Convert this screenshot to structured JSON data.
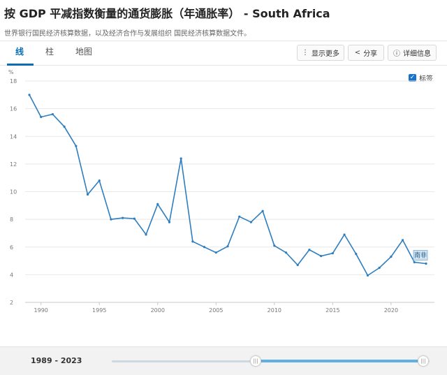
{
  "header": {
    "title": "按 GDP 平减指数衡量的通货膨胀（年通胀率） - South Africa",
    "subtitle": "世界银行国民经济核算数据，以及经济合作与发展组织 国民经济核算数据文件。"
  },
  "tabs": [
    {
      "label": "线",
      "active": true
    },
    {
      "label": "柱",
      "active": false
    },
    {
      "label": "地图",
      "active": false
    }
  ],
  "actions": {
    "more_label": "显示更多",
    "share_label": "分享",
    "details_label": "详细信息"
  },
  "icons": [
    "more-vertical-icon",
    "share-icon",
    "info-icon",
    "check-icon"
  ],
  "labels_toggle": {
    "label": "标签",
    "checked": true
  },
  "colors": {
    "accent": "#0a6eb4",
    "line": "#2e7ebf",
    "slider": "#5fb0e5",
    "end_label_bg": "#cfe3f3"
  },
  "chart_data": {
    "type": "line",
    "unit_label": "%",
    "x": [
      1989,
      1990,
      1991,
      1992,
      1993,
      1994,
      1995,
      1996,
      1997,
      1998,
      1999,
      2000,
      2001,
      2002,
      2003,
      2004,
      2005,
      2006,
      2007,
      2008,
      2009,
      2010,
      2011,
      2012,
      2013,
      2014,
      2015,
      2016,
      2017,
      2018,
      2019,
      2020,
      2021,
      2022,
      2023
    ],
    "series": [
      {
        "name": "南非",
        "values": [
          17.0,
          15.4,
          15.6,
          14.7,
          13.3,
          9.8,
          10.8,
          8.0,
          8.1,
          8.05,
          6.9,
          9.1,
          7.8,
          12.4,
          6.4,
          6.0,
          5.6,
          6.05,
          8.2,
          7.8,
          8.6,
          6.1,
          5.6,
          4.7,
          5.8,
          5.35,
          5.55,
          6.9,
          5.5,
          3.95,
          4.5,
          5.3,
          6.5,
          4.9,
          4.8
        ]
      }
    ],
    "end_label": "南非",
    "ylim": [
      2,
      18
    ],
    "y_ticks": [
      "2",
      "4",
      "6",
      "8",
      "10",
      "12",
      "14",
      "16",
      "18"
    ],
    "xlim": [
      1989,
      2023
    ],
    "x_ticks": [
      "1990",
      "1995",
      "2000",
      "2005",
      "2010",
      "2015",
      "2020"
    ],
    "grid": true
  },
  "range": {
    "label": "1989 - 2023",
    "start": 1989,
    "end": 2023
  }
}
